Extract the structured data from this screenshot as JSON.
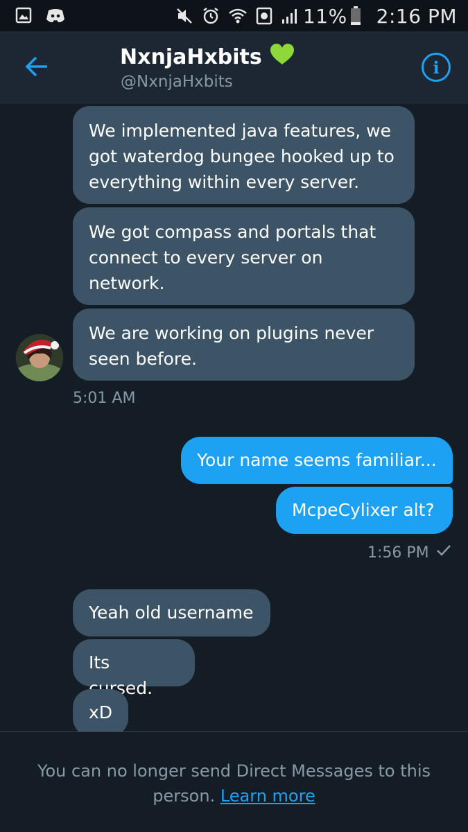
{
  "status_bar": {
    "battery": "11%",
    "time": "2:16 PM",
    "icons": [
      "image-icon",
      "discord-icon",
      "mute-icon",
      "alarm-icon",
      "wifi-icon",
      "data-saver-icon",
      "signal-icon",
      "battery-icon"
    ]
  },
  "header": {
    "name": "NxnjaHxbits",
    "handle": "@NxnjaHxbits",
    "name_badge": "green-heart-icon"
  },
  "conversation": {
    "incoming_1": [
      "We implemented java features, we got waterdog bungee hooked up to everything within every server.",
      "We got compass and portals that connect to every server on network.",
      "We are working on plugins never seen before."
    ],
    "incoming_1_time": "5:01 AM",
    "outgoing": [
      "Your name seems familiar...",
      "McpeCylixer alt?"
    ],
    "outgoing_time": "1:56 PM",
    "incoming_2": [
      "Yeah old username",
      "Its cursed.",
      "xD"
    ]
  },
  "footer": {
    "notice": "You can no longer send Direct Messages to this person.",
    "link": "Learn more"
  },
  "colors": {
    "background": "#141d26",
    "header": "#1c2733",
    "incoming_bubble": "#3d5466",
    "outgoing_bubble": "#1da1f2",
    "secondary_text": "#8899a6",
    "accent": "#1da1f2"
  }
}
